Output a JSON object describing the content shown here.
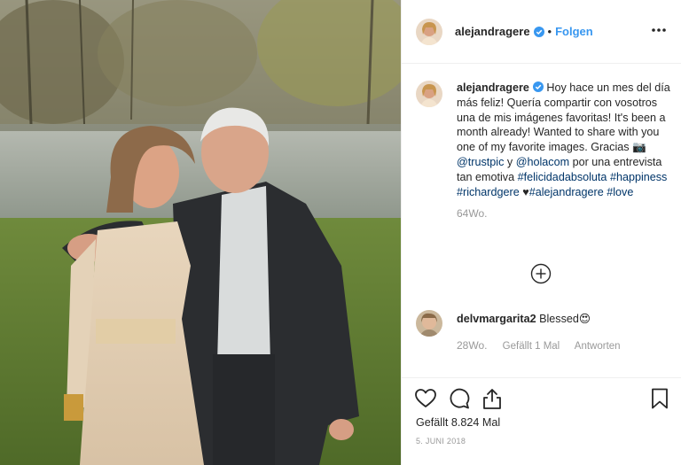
{
  "post": {
    "username": "alejandragere",
    "follow_label": "Folgen",
    "separator": "•",
    "caption": {
      "username": "alejandragere",
      "part1": " Hoy hace un mes del día más feliz! Quería compartir con vosotros una de mis imágenes favoritas! It's been a month already! Wanted to share with you one of my favorite images. Gracias ",
      "camera_emoji": "📷",
      "mention1": "@trustpic",
      "y": " y ",
      "mention2": "@holacom",
      "part2": " por una entrevista tan emotiva ",
      "hashtag1": "#felicidadabsoluta",
      "hashtag2": "#happiness",
      "hashtag3": "#richardgere",
      "heart": "♥",
      "hashtag4": "#alejandragere",
      "hashtag5": "#love",
      "age": "64Wo."
    },
    "comment": {
      "username": "delvmargarita2",
      "text": "Blessed",
      "emoji": "😍",
      "age": "28Wo.",
      "likes": "Gefällt 1 Mal",
      "reply": "Antworten"
    },
    "likes": "Gefällt 8.824 Mal",
    "date": "5. JUNI 2018"
  },
  "icons": {
    "more": "more-options-icon",
    "verified": "verified-badge-icon",
    "load_more": "plus-circle-icon",
    "like": "heart-outline-icon",
    "comment": "comment-bubble-icon",
    "share": "share-arrow-icon",
    "save": "bookmark-icon"
  },
  "colors": {
    "link": "#3897f0",
    "hashtag": "#003569",
    "muted": "#999999",
    "verified": "#3897f0"
  }
}
